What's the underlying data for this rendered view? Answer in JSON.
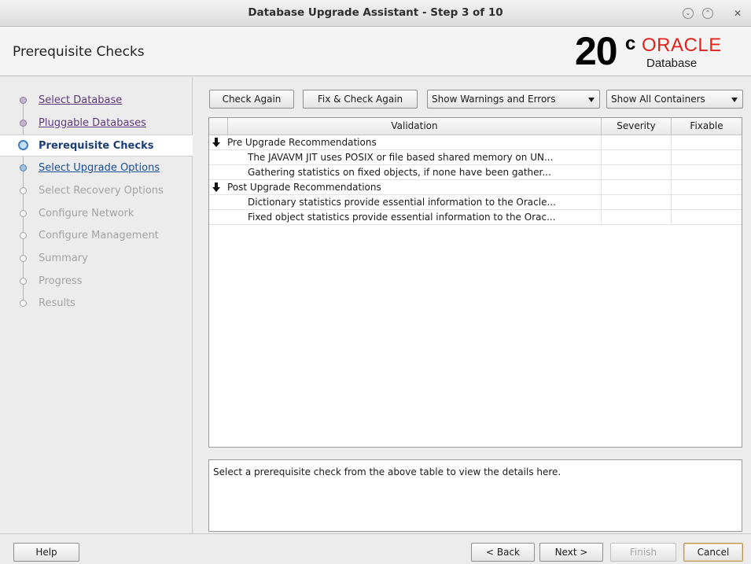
{
  "window": {
    "title": "Database Upgrade Assistant - Step 3 of 10",
    "controls": [
      "minimize-icon",
      "maximize-icon",
      "close-icon"
    ]
  },
  "header": {
    "page_title": "Prerequisite Checks",
    "logo": {
      "version": "20",
      "superscript": "c",
      "brand": "ORACLE",
      "product": "Database",
      "brand_color": "#e2231a"
    }
  },
  "sidebar": {
    "steps": [
      {
        "label": "Select Database",
        "state": "done"
      },
      {
        "label": "Pluggable Databases",
        "state": "done"
      },
      {
        "label": "Prerequisite Checks",
        "state": "current"
      },
      {
        "label": "Select Upgrade Options",
        "state": "next"
      },
      {
        "label": "Select Recovery Options",
        "state": "disabled"
      },
      {
        "label": "Configure Network",
        "state": "disabled"
      },
      {
        "label": "Configure Management",
        "state": "disabled"
      },
      {
        "label": "Summary",
        "state": "disabled"
      },
      {
        "label": "Progress",
        "state": "disabled"
      },
      {
        "label": "Results",
        "state": "disabled"
      }
    ]
  },
  "toolbar": {
    "check_again": "Check Again",
    "fix_check_again": "Fix & Check Again",
    "filter_select": "Show Warnings and Errors",
    "container_select": "Show All Containers"
  },
  "table": {
    "headers": {
      "validation": "Validation",
      "severity": "Severity",
      "fixable": "Fixable"
    },
    "rows": [
      {
        "type": "group",
        "validation": "Pre Upgrade Recommendations",
        "severity": "",
        "fixable": ""
      },
      {
        "type": "item",
        "validation": "The JAVAVM JIT uses POSIX or file based shared memory on UN...",
        "severity": "",
        "fixable": ""
      },
      {
        "type": "item",
        "validation": "Gathering statistics on fixed objects, if none have been gather...",
        "severity": "",
        "fixable": ""
      },
      {
        "type": "group",
        "validation": "Post Upgrade Recommendations",
        "severity": "",
        "fixable": ""
      },
      {
        "type": "item",
        "validation": "Dictionary statistics provide essential information to the Oracle...",
        "severity": "",
        "fixable": ""
      },
      {
        "type": "item",
        "validation": "Fixed object statistics provide essential information to the Orac...",
        "severity": "",
        "fixable": ""
      }
    ]
  },
  "details": {
    "text": "Select a prerequisite check from the above table to view the details here."
  },
  "footer": {
    "help": "Help",
    "back": "< Back",
    "next": "Next >",
    "finish": "Finish",
    "cancel": "Cancel"
  }
}
